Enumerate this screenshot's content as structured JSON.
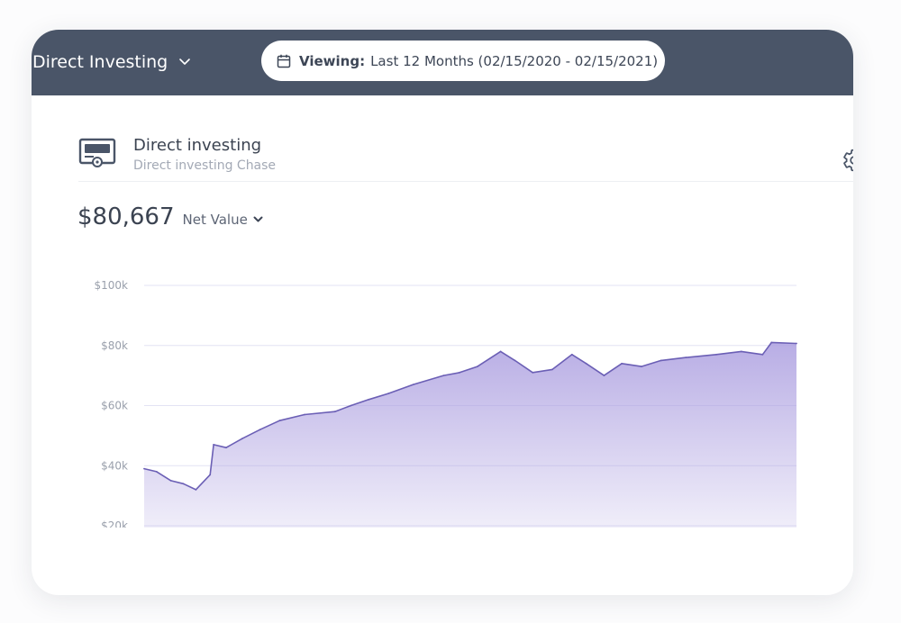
{
  "header": {
    "account_selector": "Direct Investing",
    "viewing_label": "Viewing:",
    "viewing_range": "Last 12 Months (02/15/2020 - 02/15/2021)"
  },
  "account": {
    "name": "Direct investing",
    "subtitle": "Direct investing Chase"
  },
  "summary": {
    "amount": "$80,667",
    "metric_label": "Net Value"
  },
  "icons": {
    "account_selector": "chevron-down-icon",
    "viewing": "calendar-icon",
    "account": "bank-certificate-icon",
    "settings": "gear-icon",
    "metric": "chevron-down-icon"
  },
  "colors": {
    "header_bg": "#4a5568",
    "series_line": "#6b5fb5",
    "series_fill": "#ac9fe0",
    "gridline": "#e3e3f4",
    "tick_text": "#9aa0ac"
  },
  "chart_data": {
    "type": "area",
    "title": "",
    "xlabel": "",
    "ylabel": "",
    "ylim": [
      20000,
      100000
    ],
    "yticks": [
      100000,
      80000,
      60000,
      40000,
      20000
    ],
    "ytick_labels": [
      "$100k",
      "$80k",
      "$60k",
      "$40k",
      "$20k"
    ],
    "xlim": [
      "2020-02-15",
      "2021-02-15"
    ],
    "grid": true,
    "series": [
      {
        "x": [
          "2020-02-15",
          "2020-02-22",
          "2020-03-01",
          "2020-03-08",
          "2020-03-15",
          "2020-03-23",
          "2020-03-25",
          "2020-04-01",
          "2020-04-10",
          "2020-04-20",
          "2020-05-01",
          "2020-05-15",
          "2020-06-01",
          "2020-06-10",
          "2020-06-20",
          "2020-07-01",
          "2020-07-15",
          "2020-08-01",
          "2020-08-10",
          "2020-08-20",
          "2020-09-02",
          "2020-09-10",
          "2020-09-20",
          "2020-10-01",
          "2020-10-12",
          "2020-10-20",
          "2020-10-30",
          "2020-11-09",
          "2020-11-20",
          "2020-12-01",
          "2020-12-15",
          "2021-01-01",
          "2021-01-15",
          "2021-01-27",
          "2021-02-01",
          "2021-02-15"
        ],
        "y": [
          39000,
          38000,
          35000,
          34000,
          32000,
          37000,
          47000,
          46000,
          49000,
          52000,
          55000,
          57000,
          58000,
          60000,
          62000,
          64000,
          67000,
          70000,
          71000,
          73000,
          78000,
          75000,
          71000,
          72000,
          77000,
          74000,
          70000,
          74000,
          73000,
          75000,
          76000,
          77000,
          78000,
          77000,
          81000,
          80667
        ]
      }
    ]
  }
}
